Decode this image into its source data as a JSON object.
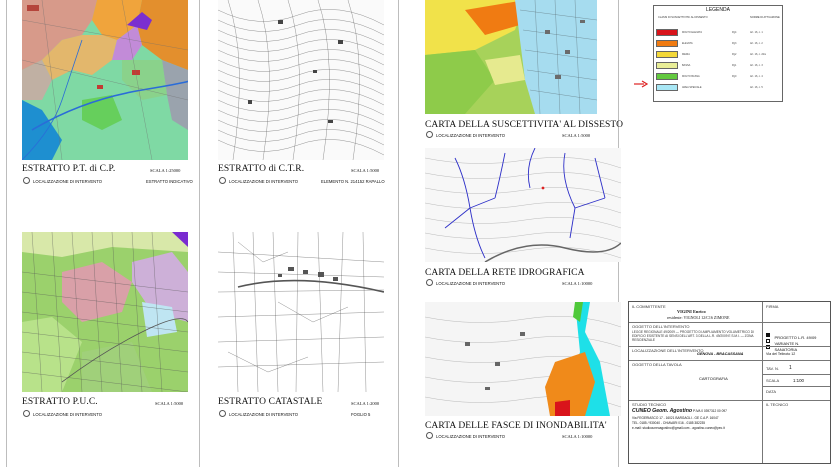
{
  "panels": {
    "ptcp": {
      "title": "ESTRATTO P.T. di C.P.",
      "scale": "SCALA 1:25000",
      "legend": "LOCALIZZAZIONE DI INTERVENTO",
      "note": "ESTRATTO INDICATIVO"
    },
    "ctr": {
      "title": "ESTRATTO di C.T.R.",
      "scale": "SCALA 1:5000",
      "legend": "LOCALIZZAZIONE DI INTERVENTO",
      "note": "ELEMENTO N. 214152 RAPALLO"
    },
    "puc": {
      "title": "ESTRATTO P.U.C.",
      "scale": "SCALA 1:5000",
      "legend": "LOCALIZZAZIONE DI INTERVENTO"
    },
    "catastale": {
      "title": "ESTRATTO CATASTALE",
      "scale": "SCALA 1:2000",
      "legend": "LOCALIZZAZIONE DI INTERVENTO",
      "note": "FOGLIO 5"
    },
    "suscettivita": {
      "title": "CARTA DELLA SUSCETTIVITA' AL DISSESTO",
      "scale": "SCALA 1:5000",
      "legend": "LOCALIZZAZIONE DI INTERVENTO"
    },
    "idrografica": {
      "title": "CARTA DELLA RETE IDROGRAFICA",
      "scale": "SCALA 1:10000",
      "legend": "LOCALIZZAZIONE DI INTERVENTO"
    },
    "inondabilita": {
      "title": "CARTA DELLE FASCE DI INONDABILITA'",
      "scale": "SCALA 1:10000",
      "legend": "LOCALIZZAZIONE DI INTERVENTO"
    }
  },
  "legend": {
    "title": "LEGENDA",
    "header": [
      "CLASSI DI SUSCETTIVITA' AL DISSESTO",
      "NORME DI ATTUAZIONE"
    ],
    "rows": [
      {
        "color": "#d9141b",
        "label": "MOLTO ELEVATA",
        "code": "Pg4",
        "art": "Art. 16, c. 1"
      },
      {
        "color": "#f07b12",
        "label": "ELEVATA",
        "code": "Pg3",
        "art": "Art. 16, c. 2"
      },
      {
        "color": "#f3d83a",
        "label": "MEDIA",
        "code": "Pg2",
        "art": "Art. 16, c. 2bis"
      },
      {
        "color": "#e9ee98",
        "label": "BASSA",
        "code": "Pg1",
        "art": "Art. 16, c. 3"
      },
      {
        "color": "#63c93f",
        "label": "MOLTO BASSA",
        "code": "Pg0",
        "art": "Art. 16, c. 4"
      },
      {
        "color": "#a8e7f5",
        "label": "AREA SPECIALE",
        "code": "",
        "art": "Art. 16, c. 5"
      }
    ]
  },
  "title_block": {
    "committente_label": "IL COMMITTENTE",
    "committente": "VIGINI Enrico",
    "committente_addr": "residente: VIGNOLI 12/C16 ZIMONE",
    "firma_label": "FIRMA",
    "oggetto_label": "OGGETTO DELL'INTERVENTO",
    "oggetto": "LEGGE REGIONALE 49/2009 — PROGETTO DI AMPLIAMENTO VOLUMETRICO DI EDIFICIO ESISTENTE AI SENSI DELL'ART. 3 DELLA L.R. 49/2009 E S.M.I. — ZONA RESIDENZIALE",
    "options": [
      "PROGETTO L.R. 49/09",
      "VARIANTE N.",
      "SANATORIA"
    ],
    "localizzazione_label": "LOCALIZZAZIONE DELL'INTERVENTO",
    "comune": "GENOVA - BRACASSANA",
    "localita": "Via del Telinoto 12",
    "tavola_oggetto_label": "OGGETTO DELLA TAVOLA",
    "tavola_oggetto": "CARTOGRAFIA",
    "tav_label": "TAV. N.",
    "tav_value": "1",
    "scala_label": "SCALA",
    "scala_value": "1:100",
    "data_label": "DATA",
    "studio_label": "STUDIO TECNICO",
    "studio_name": "CUNEO Geom. Agostino",
    "studio_piva": "P.IVA 0 0397312 00 097",
    "studio_addr": "Via FEGERIASCO 17 - 16021 BARGAGLI - GE C.A.P. 16047",
    "studio_tel": "TEL. 0185 / 930040 - CHIAVARI 016 - 0185 382235",
    "studio_mail": "e-mail: studiocuneoagostino@gmail.com - agostino.cuneo@pec.it",
    "tecnico_label": "IL TECNICO"
  }
}
